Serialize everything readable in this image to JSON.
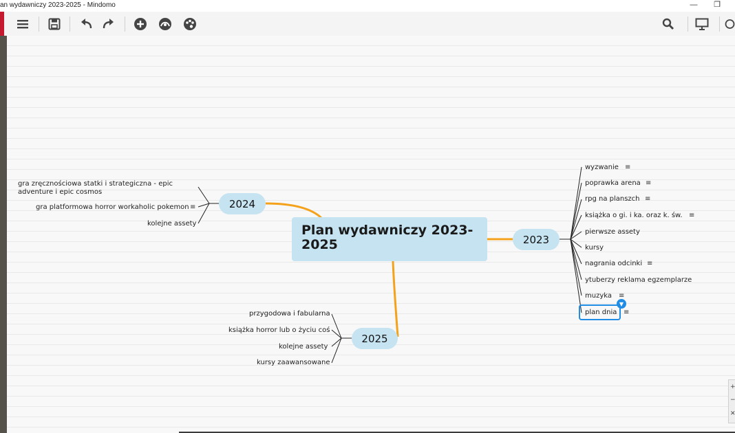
{
  "window": {
    "title": "an wydawniczy 2023-2025 - Mindomo",
    "minimize_glyph": "—",
    "restore_glyph": "❐"
  },
  "toolbar": {
    "icons": [
      "menu-icon",
      "save-icon",
      "undo-icon",
      "redo-icon",
      "add-topic-icon",
      "theme-icon",
      "palette-icon",
      "search-icon",
      "present-icon"
    ]
  },
  "map": {
    "central": "Plan wydawniczy 2023-2025",
    "branches": {
      "b2024": {
        "label": "2024",
        "items": [
          {
            "text": "gra zręcznościowa statki i strategiczna - epic adventure i epic cosmos",
            "note": false
          },
          {
            "text": "gra platformowa horror workaholic pokemon",
            "note": true
          },
          {
            "text": "kolejne assety",
            "note": false
          }
        ]
      },
      "b2025": {
        "label": "2025",
        "items": [
          {
            "text": "przygodowa i fabularna",
            "note": false
          },
          {
            "text": "książka horror lub o życiu coś",
            "note": false
          },
          {
            "text": "kolejne assety",
            "note": false
          },
          {
            "text": "kursy zaawansowane",
            "note": false
          }
        ]
      },
      "b2023": {
        "label": "2023",
        "items": [
          {
            "text": "wyzwanie",
            "note": true
          },
          {
            "text": "poprawka arena",
            "note": true
          },
          {
            "text": "rpg na planszch",
            "note": true
          },
          {
            "text": "książka o gi. i ka. oraz k. św.",
            "note": true
          },
          {
            "text": "pierwsze assety",
            "note": false
          },
          {
            "text": "kursy",
            "note": false
          },
          {
            "text": "nagrania odcinki",
            "note": true
          },
          {
            "text": "ytuberzy reklama egzemplarze",
            "note": false
          },
          {
            "text": "muzyka",
            "note": true
          },
          {
            "text": "plan dnia",
            "note": true
          }
        ]
      }
    },
    "selected": "plan dnia",
    "note_glyph": "≡"
  },
  "colors": {
    "main_branch": "#f4a21c",
    "topic_fill": "#c5e3f0",
    "selection": "#1f8ce6"
  }
}
